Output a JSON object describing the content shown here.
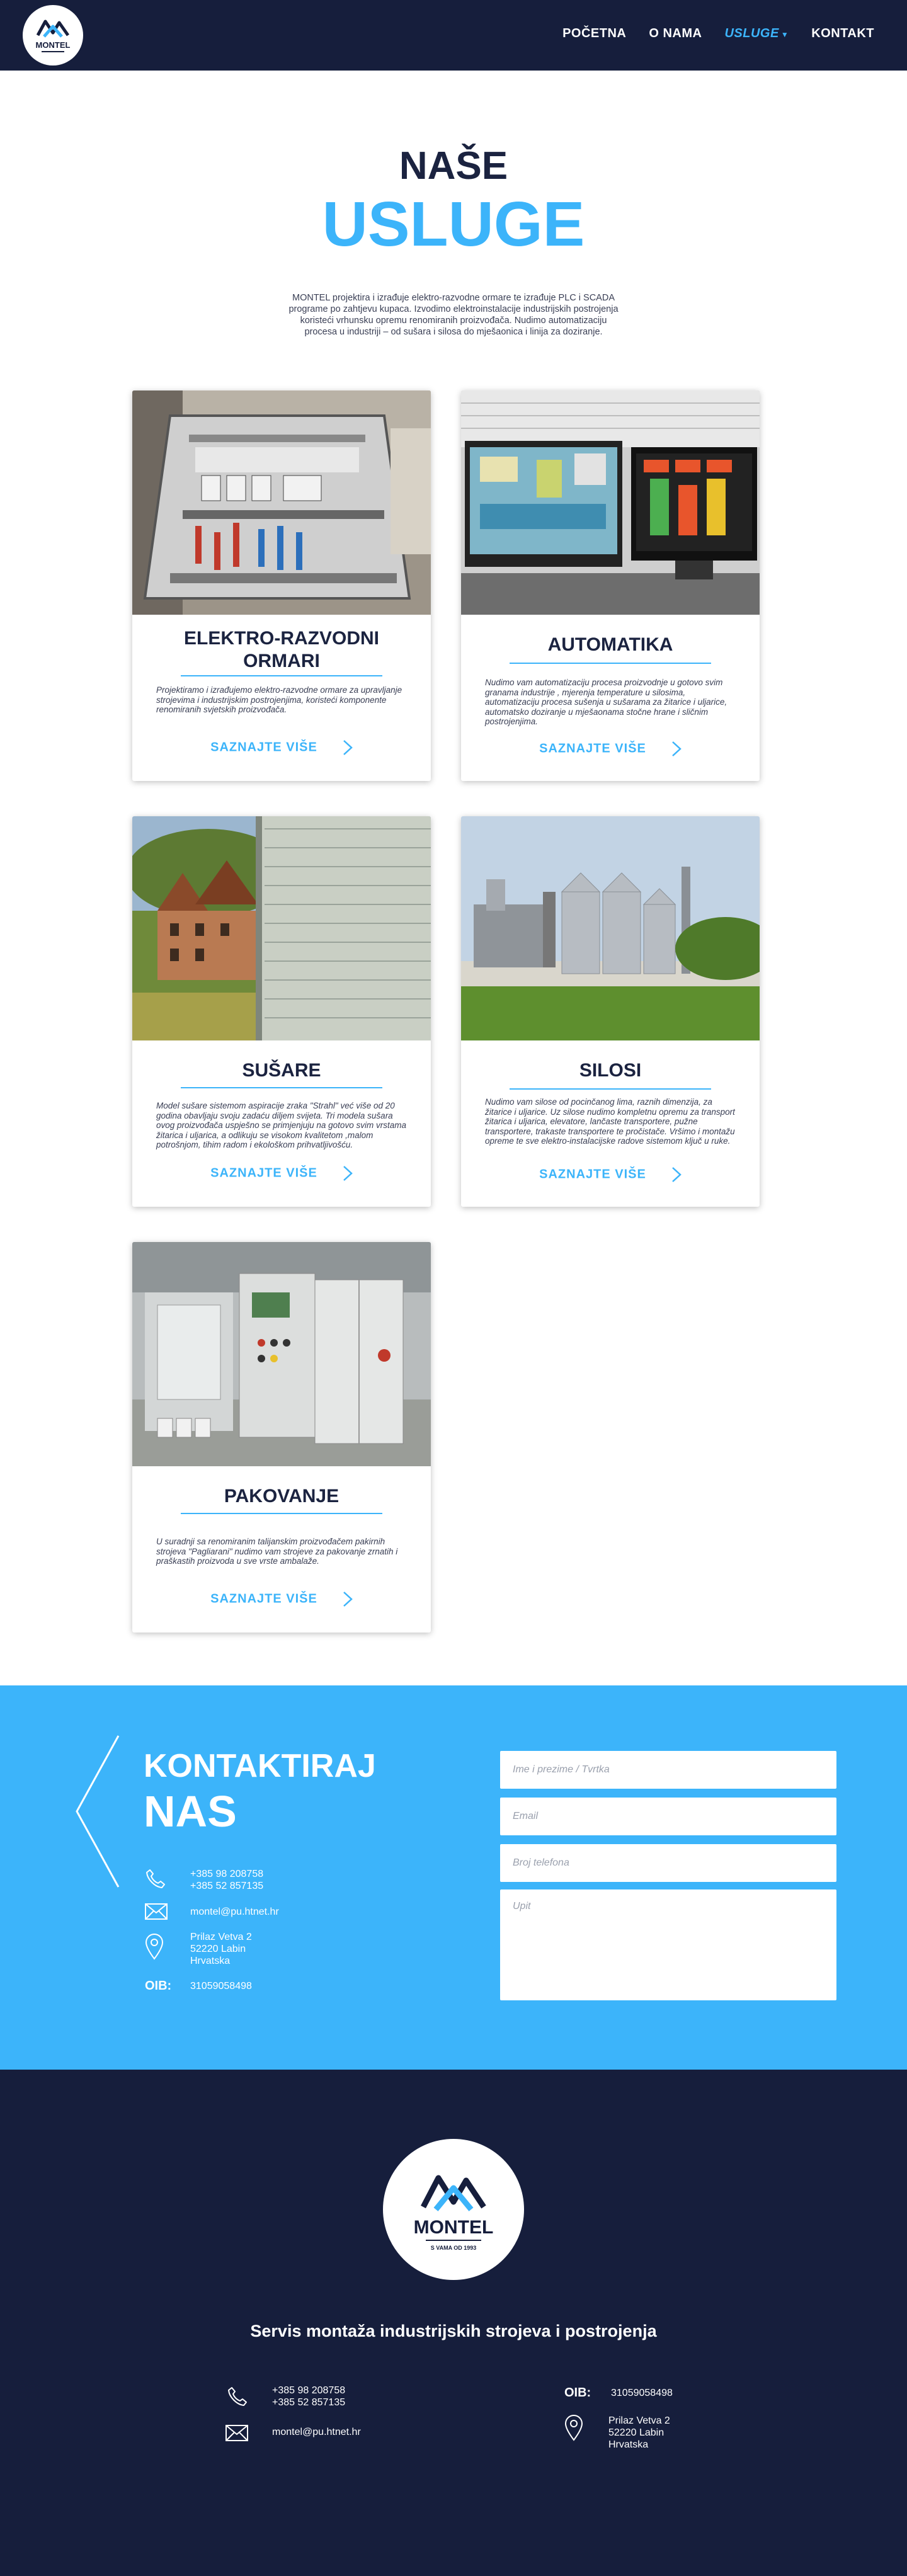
{
  "nav": {
    "logo_text": "MONTEL",
    "items": [
      {
        "label": "POČETNA",
        "active": false
      },
      {
        "label": "O NAMA",
        "active": false
      },
      {
        "label": "USLUGE",
        "active": true,
        "has_dropdown": true
      },
      {
        "label": "KONTAKT",
        "active": false
      }
    ]
  },
  "hero": {
    "title_line1": "NAŠE",
    "title_line2": "USLUGE",
    "intro": "MONTEL projektira i izrađuje elektro-razvodne ormare te izrađuje PLC i SCADA\nprograme po zahtjevu kupaca.  Izvodimo elektroinstalacije industrijskih postrojenja\nkoristeći vrhunsku opremu renomiranih proizvođača. Nudimo automatizaciju\nprocesa u industriji – od sušara i silosa do mješaonica i linija za doziranje."
  },
  "services": [
    {
      "title": "ELEKTRO-RAZVODNI ORMARI",
      "text": "Projektiramo i izrađujemo elektro-razvodne ormare za upravljanje strojevima i industrijskim postrojenjima, koristeći komponente renomiranih svjetskih proizvođača.",
      "cta": "SAZNAJTE VIŠE",
      "image_icon": "electrical-cabinet-photo"
    },
    {
      "title": "AUTOMATIKA",
      "text": "Nudimo vam automatizaciju procesa proizvodnje u gotovo svim granama industrije , mjerenja temperature u silosima, automatizaciju procesa sušenja u sušarama za žitarice i uljarice, automatsko doziranje u mješaonama stočne hrane i sličnim postrojenjima.",
      "cta": "SAZNAJTE VIŠE",
      "image_icon": "scada-monitors-photo"
    },
    {
      "title": "SUŠARE",
      "text": "Model  sušare sistemom aspiracije zraka \"Strahl\" već više od 20 godina  obavljaju svoju zadaću diljem svijeta. Tri modela sušara ovog  proizvođača uspješno se primjenjuju na  gotovo svim vrstama  žitarica i uljarica, a odlikuju se visokom kvalitetom ,malom potrošnjom, tihim radom i ekološkom prihvatljivošću.",
      "cta": "SAZNAJTE VIŠE",
      "image_icon": "dryer-tower-photo"
    },
    {
      "title": "SILOSI",
      "text": "Nudimo vam  silose od pocinčanog  lima, raznih dimenzija, za žitarice i uljarice. Uz silose nudimo kompletnu opremu za transport  žitarica i uljarica, elevatore, lančaste transportere, pužne transportere, trakaste transportere te pročistače. Vršimo i montažu opreme te sve elektro-instalacijske radove sistemom ključ u ruke.",
      "cta": "SAZNAJTE VIŠE",
      "image_icon": "grain-silos-photo"
    },
    {
      "title": "PAKOVANJE",
      "text": "U suradnji  sa renomiranim  talijanskim proizvođačem pakirnih strojeva \"Pagliarani\" nudimo vam strojeve za pakovanje zrnatih i praškastih proizvoda u sve  vrste  ambalaže.",
      "cta": "SAZNAJTE VIŠE",
      "image_icon": "packaging-machine-photo"
    }
  ],
  "contact": {
    "heading_line1": "KONTAKTIRAJ",
    "heading_line2": "NAS",
    "phone": "+385 98 208758\n+385 52 857135",
    "email": "montel@pu.htnet.hr",
    "address": "Prilaz Vetva 2\n52220 Labin\nHrvatska",
    "oib_label": "OIB:",
    "oib_value": "31059058498",
    "form": {
      "name_placeholder": "Ime i prezime / Tvrtka",
      "email_placeholder": "Email",
      "phone_placeholder": "Broj telefona",
      "message_placeholder": "Upit"
    }
  },
  "footer": {
    "logo_text": "MONTEL",
    "logo_subtext": "S VAMA OD 1993",
    "tagline": "Servis montaža industrijskih strojeva i postrojenja",
    "phone": "+385 98 208758\n+385 52 857135",
    "email": "montel@pu.htnet.hr",
    "oib_label": "OIB:",
    "oib_value": "31059058498",
    "address": "Prilaz Vetva 2\n52220 Labin\nHrvatska"
  },
  "colors": {
    "navy": "#161e3c",
    "accent_blue": "#3cb4fa",
    "white": "#ffffff"
  }
}
